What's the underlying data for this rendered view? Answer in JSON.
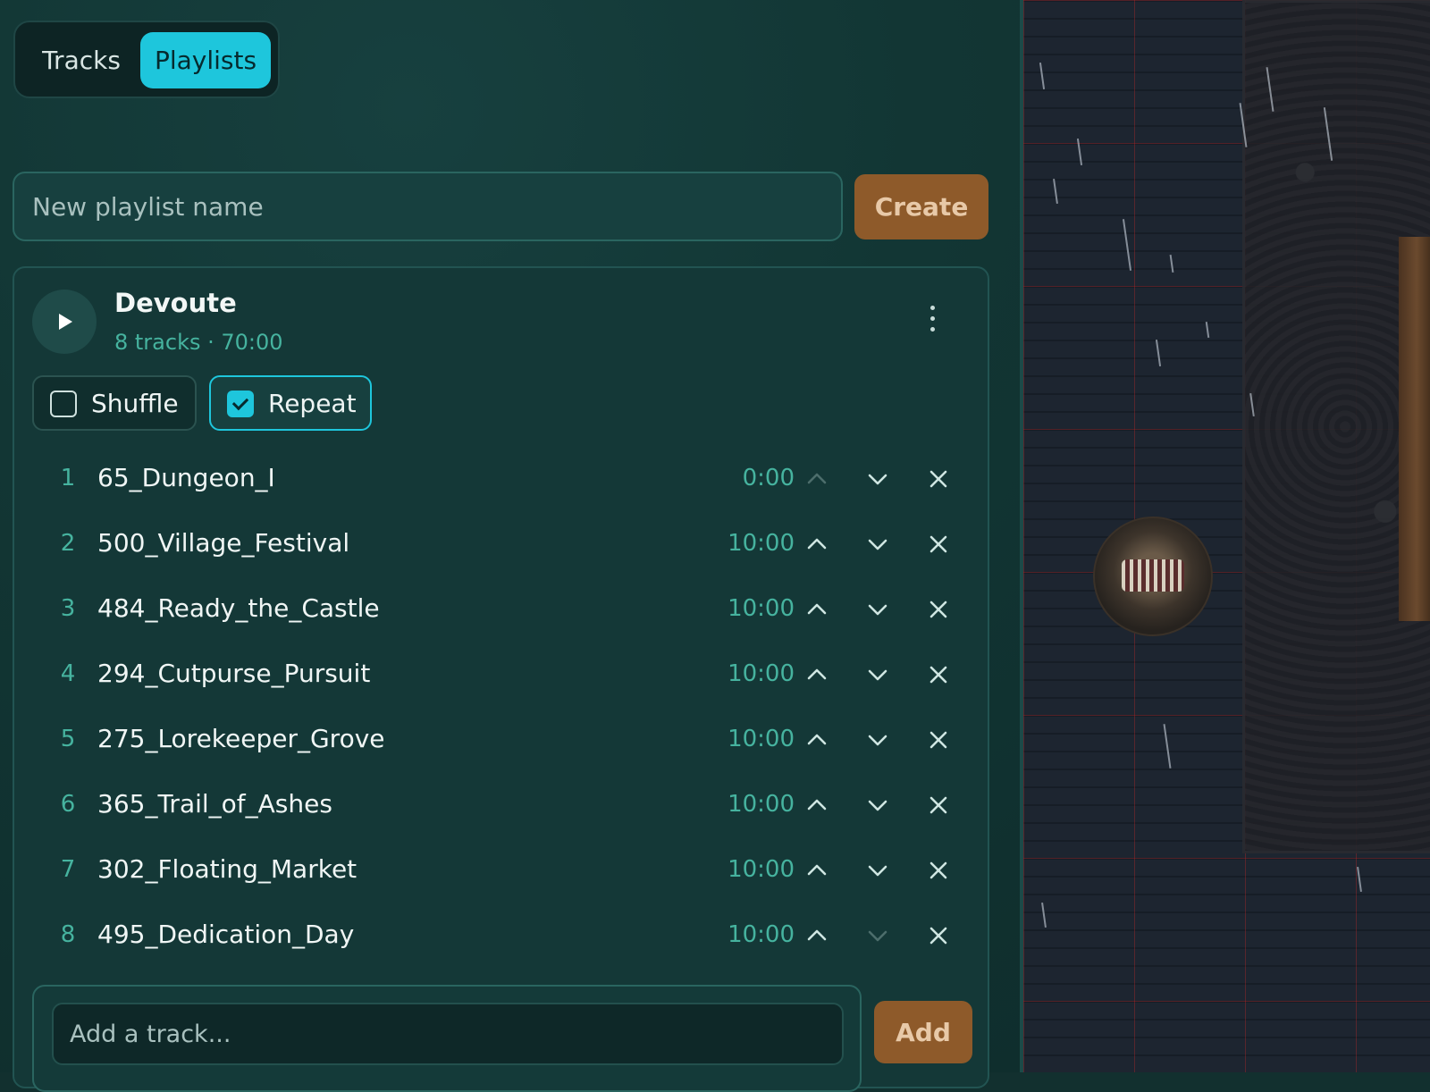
{
  "tabs": {
    "tracks": "Tracks",
    "playlists": "Playlists",
    "active": "Playlists"
  },
  "new_playlist": {
    "placeholder": "New playlist name",
    "value": "",
    "create_label": "Create"
  },
  "playlist": {
    "title": "Devoute",
    "meta": "8 tracks · 70:00",
    "shuffle": {
      "label": "Shuffle",
      "checked": false
    },
    "repeat": {
      "label": "Repeat",
      "checked": true
    },
    "tracks": [
      {
        "num": "1",
        "name": "65_Dungeon_I",
        "duration": "0:00"
      },
      {
        "num": "2",
        "name": "500_Village_Festival",
        "duration": "10:00"
      },
      {
        "num": "3",
        "name": "484_Ready_the_Castle",
        "duration": "10:00"
      },
      {
        "num": "4",
        "name": "294_Cutpurse_Pursuit",
        "duration": "10:00"
      },
      {
        "num": "5",
        "name": "275_Lorekeeper_Grove",
        "duration": "10:00"
      },
      {
        "num": "6",
        "name": "365_Trail_of_Ashes",
        "duration": "10:00"
      },
      {
        "num": "7",
        "name": "302_Floating_Market",
        "duration": "10:00"
      },
      {
        "num": "8",
        "name": "495_Dedication_Day",
        "duration": "10:00"
      }
    ],
    "add_track": {
      "placeholder": "Add a track...",
      "value": "",
      "button_label": "Add"
    }
  },
  "icons": {
    "play": "play-icon",
    "menu": "more-vertical-icon",
    "up": "chevron-up-icon",
    "down": "chevron-down-icon",
    "remove": "close-icon"
  },
  "colors": {
    "accent": "#1ec6dc",
    "action": "#8e5a2a",
    "muted_teal": "#46b39f",
    "panel": "#143837"
  }
}
